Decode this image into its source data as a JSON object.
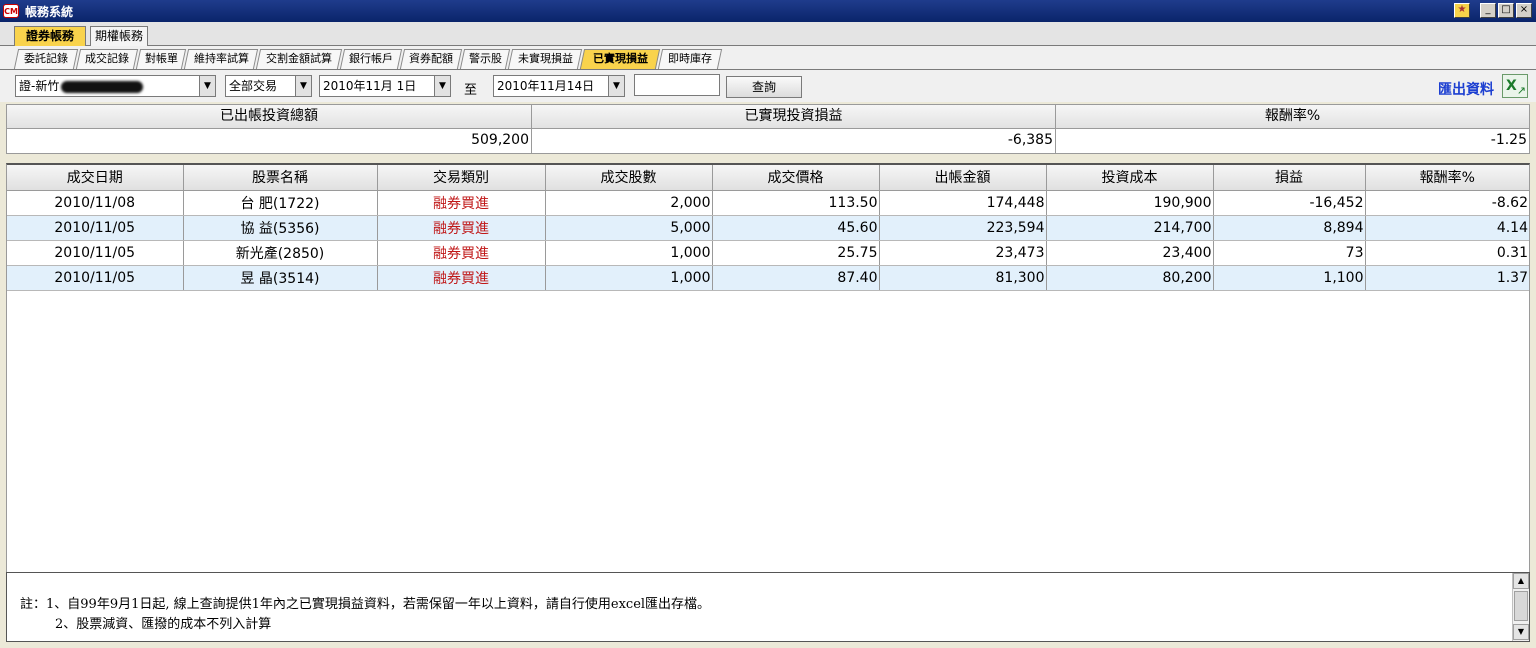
{
  "window": {
    "icon_text": "CM",
    "title": "帳務系統",
    "controls": [
      "★",
      "_",
      "□",
      "×"
    ]
  },
  "top_tabs": [
    {
      "label": "證券帳務",
      "active": true
    },
    {
      "label": "期權帳務",
      "active": false
    }
  ],
  "sub_tabs": [
    {
      "label": "委託記錄"
    },
    {
      "label": "成交記錄"
    },
    {
      "label": "對帳單"
    },
    {
      "label": "維持率試算"
    },
    {
      "label": "交割金額試算"
    },
    {
      "label": "銀行帳戶"
    },
    {
      "label": "資券配額"
    },
    {
      "label": "警示股"
    },
    {
      "label": "未實現損益"
    },
    {
      "label": "已實現損益",
      "active": true
    },
    {
      "label": "即時庫存"
    }
  ],
  "filters": {
    "account": "證-新竹",
    "trade_type": "全部交易",
    "date_from": "2010年11月 1日",
    "to_label": "至",
    "date_to": "2010年11月14日",
    "text_value": "",
    "query_label": "查詢",
    "export_label": "匯出資料"
  },
  "summary": {
    "headers": [
      "已出帳投資總額",
      "已實現投資損益",
      "報酬率%"
    ],
    "values": [
      "509,200",
      "-6,385",
      "-1.25"
    ]
  },
  "table": {
    "headers": [
      "成交日期",
      "股票名稱",
      "交易類別",
      "成交股數",
      "成交價格",
      "出帳金額",
      "投資成本",
      "損益",
      "報酬率%"
    ],
    "rows": [
      [
        "2010/11/08",
        "台 肥(1722)",
        "融券買進",
        "2,000",
        "113.50",
        "174,448",
        "190,900",
        "-16,452",
        "-8.62"
      ],
      [
        "2010/11/05",
        "協 益(5356)",
        "融券買進",
        "5,000",
        "45.60",
        "223,594",
        "214,700",
        "8,894",
        "4.14"
      ],
      [
        "2010/11/05",
        "新光產(2850)",
        "融券買進",
        "1,000",
        "25.75",
        "23,473",
        "23,400",
        "73",
        "0.31"
      ],
      [
        "2010/11/05",
        "昱 晶(3514)",
        "融券買進",
        "1,000",
        "87.40",
        "81,300",
        "80,200",
        "1,100",
        "1.37"
      ]
    ]
  },
  "notes": {
    "line1": "註：1、自99年9月1日起, 線上查詢提供1年內之已實現損益資料，若需保留一年以上資料，請自行使用excel匯出存檔。",
    "line2": "2、股票減資、匯撥的成本不列入計算"
  }
}
